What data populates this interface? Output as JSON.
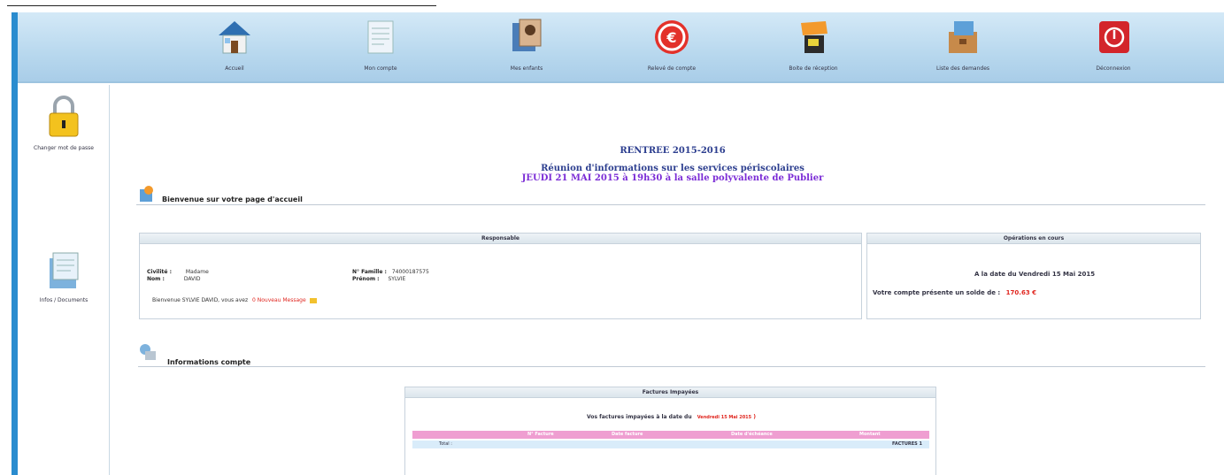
{
  "nav": {
    "items": [
      {
        "label": "Accueil",
        "icon": "house-icon"
      },
      {
        "label": "Mon compte",
        "icon": "document-icon"
      },
      {
        "label": "Mes enfants",
        "icon": "children-icon"
      },
      {
        "label": "Relevé de compte",
        "icon": "euro-icon"
      },
      {
        "label": "Boite de réception",
        "icon": "inbox-icon"
      },
      {
        "label": "Liste des demandes",
        "icon": "requests-box-icon"
      },
      {
        "label": "Déconnexion",
        "icon": "power-icon"
      }
    ]
  },
  "sidebar": {
    "items": [
      {
        "label": "Changer mot de passe",
        "icon": "padlock-icon"
      },
      {
        "label": "Infos / Documents",
        "icon": "documents-icon"
      }
    ]
  },
  "announcement": {
    "title": "RENTREE 2015-2016",
    "line1": "Réunion d'informations sur les services périscolaires",
    "line2": "JEUDI 21 MAI 2015 à 19h30 à la salle polyvalente de Publier"
  },
  "welcome": {
    "title": "Bienvenue sur votre page d'accueil"
  },
  "responsable": {
    "header": "Responsable",
    "civilite_label": "Civilité :",
    "civilite_value": "Madame",
    "nom_label": "Nom :",
    "nom_value": "DAVID",
    "famille_label": "N° Famille :",
    "famille_value": "74000187575",
    "prenom_label": "Prénom :",
    "prenom_value": "SYLVIE",
    "message_line": "Bienvenue SYLVIE DAVID, vous avez",
    "new_messages": "0 Nouveau Message"
  },
  "operations": {
    "header": "Opérations en cours",
    "date_line": "A la date du Vendredi 15 Mai 2015",
    "balance_label": "Votre compte présente un solde de :",
    "balance_value": "170.63 €"
  },
  "account_info": {
    "title": "Informations compte"
  },
  "invoices": {
    "header": "Factures Impayées",
    "intro_label": "Vos factures impayées à la date du",
    "intro_date": "Vendredi 15 Mai 2015",
    "columns": [
      "N° Facture",
      "Date facture",
      "Date d'échéance",
      "Montant"
    ],
    "total_label": "Total :",
    "total_value": "FACTURES 1"
  },
  "colors": {
    "nav_bar": "#b8d8ee",
    "accent_strip": "#2a8ccf",
    "heading_blue": "#2c3e8f",
    "heading_purple": "#7b2cd6",
    "red": "#e0261f",
    "invoice_header": "#ef9ed1",
    "invoice_row": "#d9ecfa"
  }
}
